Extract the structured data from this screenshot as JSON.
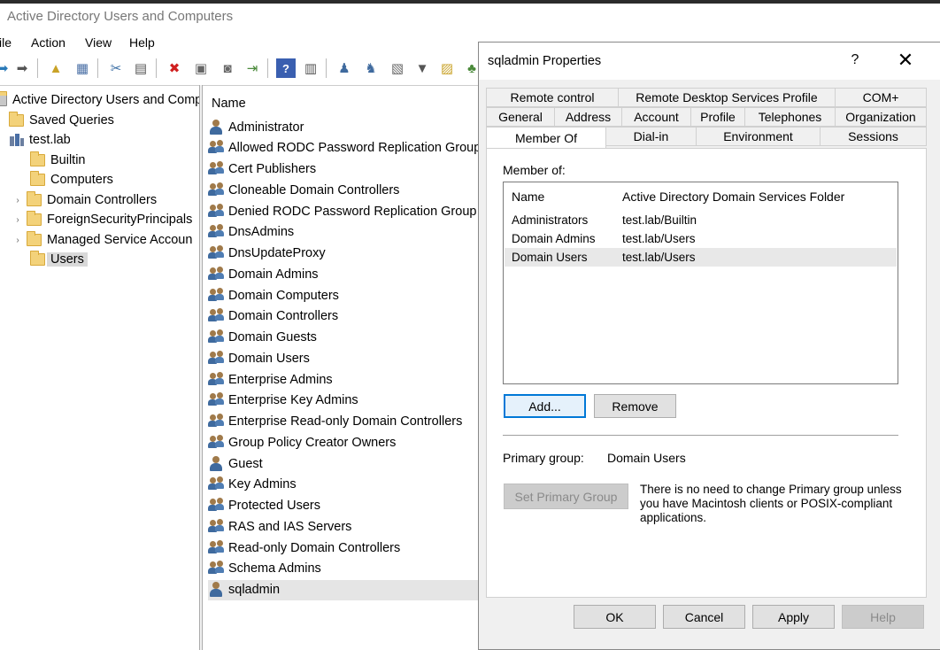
{
  "app": {
    "title": "Active Directory Users and Computers",
    "menu": [
      "ile",
      "Action",
      "View",
      "Help"
    ]
  },
  "tree": {
    "items": [
      {
        "label": "Active Directory Users and Comp",
        "icon": "console-root-icon",
        "expandable": false
      },
      {
        "label": "Saved Queries",
        "icon": "folder-icon",
        "expandable": false
      },
      {
        "label": "test.lab",
        "icon": "domain-icon",
        "expandable": false
      },
      {
        "label": "Builtin",
        "icon": "folder-icon",
        "expandable": false
      },
      {
        "label": "Computers",
        "icon": "folder-icon",
        "expandable": false
      },
      {
        "label": "Domain Controllers",
        "icon": "ou-icon",
        "expandable": true
      },
      {
        "label": "ForeignSecurityPrincipals",
        "icon": "folder-icon",
        "expandable": true
      },
      {
        "label": "Managed Service Accoun",
        "icon": "folder-icon",
        "expandable": true
      },
      {
        "label": "Users",
        "icon": "folder-icon",
        "expandable": false,
        "selected": true
      }
    ]
  },
  "list": {
    "header": "Name",
    "items": [
      {
        "name": "Administrator",
        "type": "user"
      },
      {
        "name": "Allowed RODC Password Replication Group",
        "type": "group"
      },
      {
        "name": "Cert Publishers",
        "type": "group"
      },
      {
        "name": "Cloneable Domain Controllers",
        "type": "group"
      },
      {
        "name": "Denied RODC Password Replication Group",
        "type": "group"
      },
      {
        "name": "DnsAdmins",
        "type": "group"
      },
      {
        "name": "DnsUpdateProxy",
        "type": "group"
      },
      {
        "name": "Domain Admins",
        "type": "group"
      },
      {
        "name": "Domain Computers",
        "type": "group"
      },
      {
        "name": "Domain Controllers",
        "type": "group"
      },
      {
        "name": "Domain Guests",
        "type": "group"
      },
      {
        "name": "Domain Users",
        "type": "group"
      },
      {
        "name": "Enterprise Admins",
        "type": "group"
      },
      {
        "name": "Enterprise Key Admins",
        "type": "group"
      },
      {
        "name": "Enterprise Read-only Domain Controllers",
        "type": "group"
      },
      {
        "name": "Group Policy Creator Owners",
        "type": "group"
      },
      {
        "name": "Guest",
        "type": "user"
      },
      {
        "name": "Key Admins",
        "type": "group"
      },
      {
        "name": "Protected Users",
        "type": "group"
      },
      {
        "name": "RAS and IAS Servers",
        "type": "group"
      },
      {
        "name": "Read-only Domain Controllers",
        "type": "group"
      },
      {
        "name": "Schema Admins",
        "type": "group"
      },
      {
        "name": "sqladmin",
        "type": "user",
        "selected": true
      }
    ]
  },
  "dialog": {
    "title": "sqladmin Properties",
    "help_glyph": "?",
    "close_glyph": "✕",
    "tabs_row1": [
      "Remote control",
      "Remote Desktop Services Profile",
      "COM+"
    ],
    "tabs_row2": [
      "General",
      "Address",
      "Account",
      "Profile",
      "Telephones",
      "Organization"
    ],
    "tabs_row3": [
      "Member Of",
      "Dial-in",
      "Environment",
      "Sessions"
    ],
    "active_tab": "Member Of",
    "member_of_label": "Member of:",
    "columns": [
      "Name",
      "Active Directory Domain Services Folder"
    ],
    "members": [
      {
        "name": "Administrators",
        "folder": "test.lab/Builtin"
      },
      {
        "name": "Domain Admins",
        "folder": "test.lab/Users"
      },
      {
        "name": "Domain Users",
        "folder": "test.lab/Users",
        "selected": true
      }
    ],
    "add_button": "Add...",
    "remove_button": "Remove",
    "primary_group_label": "Primary group:",
    "primary_group_value": "Domain Users",
    "set_primary_button": "Set Primary Group",
    "primary_note": "There is no need to change Primary group unless you have Macintosh clients or POSIX-compliant applications.",
    "ok_button": "OK",
    "cancel_button": "Cancel",
    "apply_button": "Apply",
    "help_button": "Help"
  }
}
